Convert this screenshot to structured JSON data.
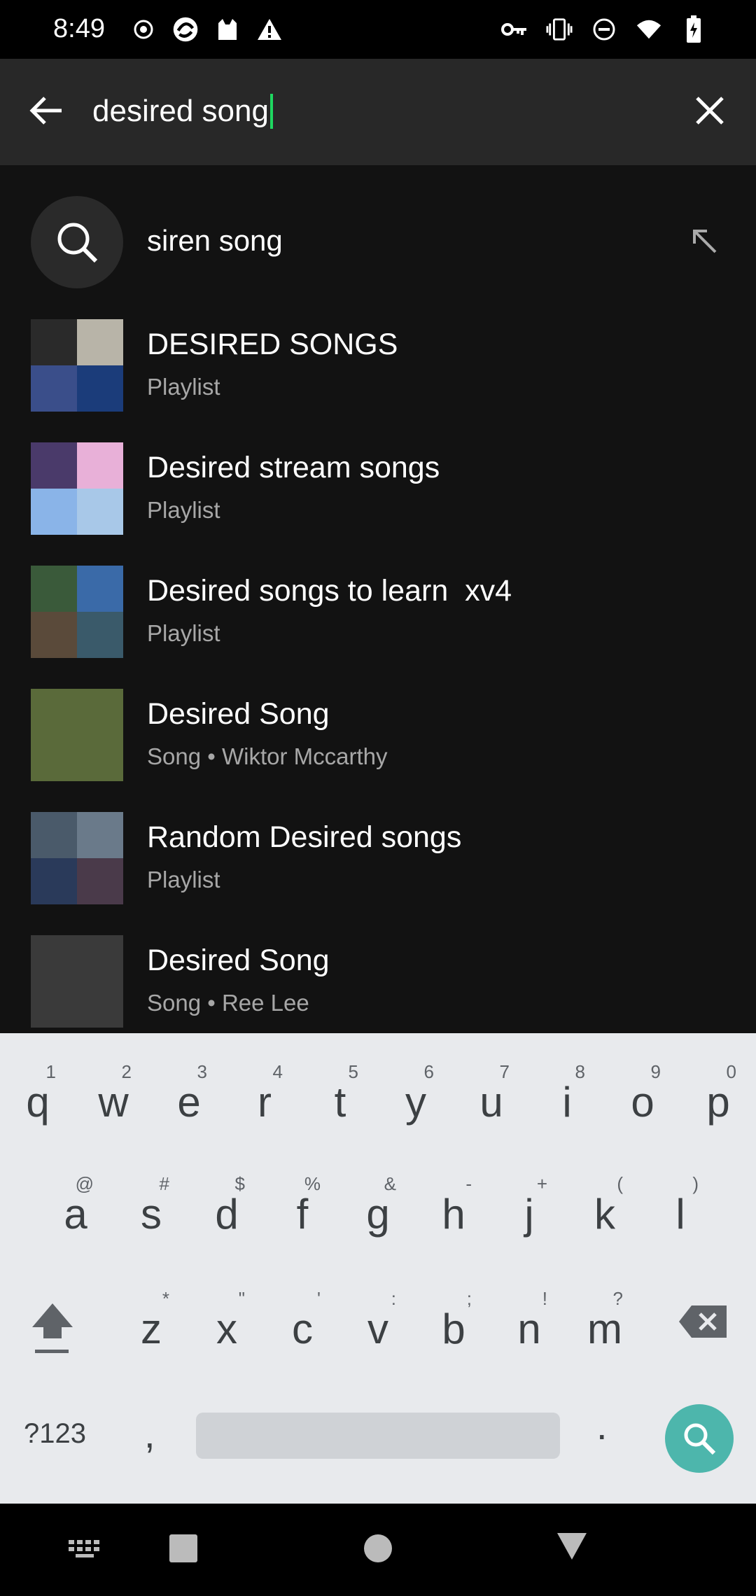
{
  "status_bar": {
    "time": "8:49",
    "left_icons": [
      "record-icon",
      "sync-icon",
      "cat-icon",
      "warning-icon"
    ],
    "right_icons": [
      "key-icon",
      "vibrate-icon",
      "dnd-icon",
      "wifi-icon",
      "battery-charging-icon"
    ]
  },
  "search": {
    "query": "desired song",
    "back_icon": "arrow-left-icon",
    "clear_icon": "close-icon"
  },
  "suggestion": {
    "text": "siren song",
    "icon": "search-icon",
    "fill_icon": "arrow-up-left-icon"
  },
  "results": [
    {
      "title": "DESIRED SONGS",
      "subtitle": "Playlist",
      "art_colors": [
        "#2a2a2a",
        "#b8b4a8",
        "#3a4e8a",
        "#1b3c7a"
      ]
    },
    {
      "title": "Desired stream songs",
      "subtitle": "Playlist",
      "art_colors": [
        "#4a3a6a",
        "#e8b0d8",
        "#8ab4e8",
        "#a8c8e8"
      ]
    },
    {
      "title": "Desired songs to learn  xv4",
      "subtitle": "Playlist",
      "art_colors": [
        "#3a5a3a",
        "#3a6aa8",
        "#5a4a3a",
        "#3a5a6a"
      ]
    },
    {
      "title": "Desired Song",
      "subtitle": "Song • Wiktor Mccarthy",
      "art_colors": [
        "#5a6a3a"
      ]
    },
    {
      "title": "Random Desired songs",
      "subtitle": "Playlist",
      "art_colors": [
        "#4a5a6a",
        "#6a7a8a",
        "#2a3a5a",
        "#4a3a4a"
      ]
    },
    {
      "title": "Desired Song",
      "subtitle": "Song • Ree Lee",
      "art_colors": [
        "#3a3a3a"
      ]
    }
  ],
  "keyboard": {
    "row1": [
      {
        "k": "q",
        "h": "1"
      },
      {
        "k": "w",
        "h": "2"
      },
      {
        "k": "e",
        "h": "3"
      },
      {
        "k": "r",
        "h": "4"
      },
      {
        "k": "t",
        "h": "5"
      },
      {
        "k": "y",
        "h": "6"
      },
      {
        "k": "u",
        "h": "7"
      },
      {
        "k": "i",
        "h": "8"
      },
      {
        "k": "o",
        "h": "9"
      },
      {
        "k": "p",
        "h": "0"
      }
    ],
    "row2": [
      {
        "k": "a",
        "h": "@"
      },
      {
        "k": "s",
        "h": "#"
      },
      {
        "k": "d",
        "h": "$"
      },
      {
        "k": "f",
        "h": "%"
      },
      {
        "k": "g",
        "h": "&"
      },
      {
        "k": "h",
        "h": "-"
      },
      {
        "k": "j",
        "h": "+"
      },
      {
        "k": "k",
        "h": "("
      },
      {
        "k": "l",
        "h": ")"
      }
    ],
    "row3": [
      {
        "k": "z",
        "h": "*"
      },
      {
        "k": "x",
        "h": "\""
      },
      {
        "k": "c",
        "h": "'"
      },
      {
        "k": "v",
        "h": ":"
      },
      {
        "k": "b",
        "h": ";"
      },
      {
        "k": "n",
        "h": "!"
      },
      {
        "k": "m",
        "h": "?"
      }
    ],
    "symbols_label": "?123",
    "comma": ",",
    "period": ".",
    "accent_color": "#4db6ac"
  },
  "nav_bar": {
    "icons": [
      "keyboard-switch-icon",
      "recents-icon",
      "home-icon",
      "back-icon"
    ]
  }
}
